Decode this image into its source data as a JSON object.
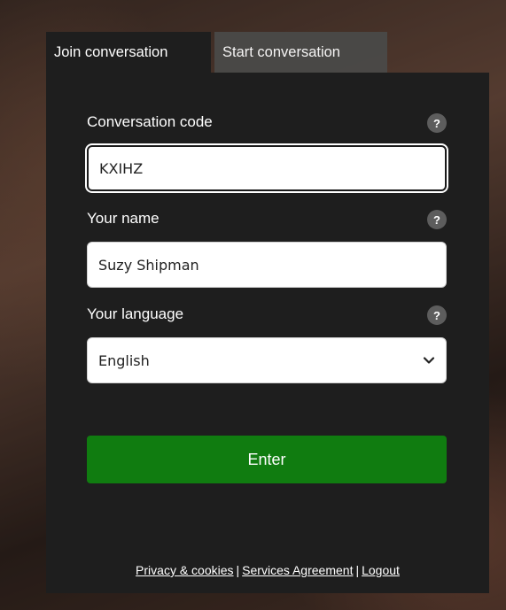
{
  "tabs": [
    {
      "label": "Join conversation",
      "active": true
    },
    {
      "label": "Start conversation",
      "active": false
    }
  ],
  "form": {
    "code": {
      "label": "Conversation code",
      "help": "?",
      "value": "KXIHZ"
    },
    "name": {
      "label": "Your name",
      "help": "?",
      "value": "Suzy Shipman"
    },
    "language": {
      "label": "Your language",
      "help": "?",
      "selected": "English"
    },
    "enter_label": "Enter"
  },
  "footer": {
    "links": [
      "Privacy & cookies",
      "Services Agreement",
      "Logout"
    ],
    "separator": "|"
  },
  "colors": {
    "panel": "#1e1e1e",
    "inactive_tab": "#4a4a48",
    "enter_button": "#107c10",
    "help_badge": "#5d5d5d"
  },
  "icons": {
    "help": "question-mark-icon",
    "dropdown": "chevron-down-icon"
  }
}
